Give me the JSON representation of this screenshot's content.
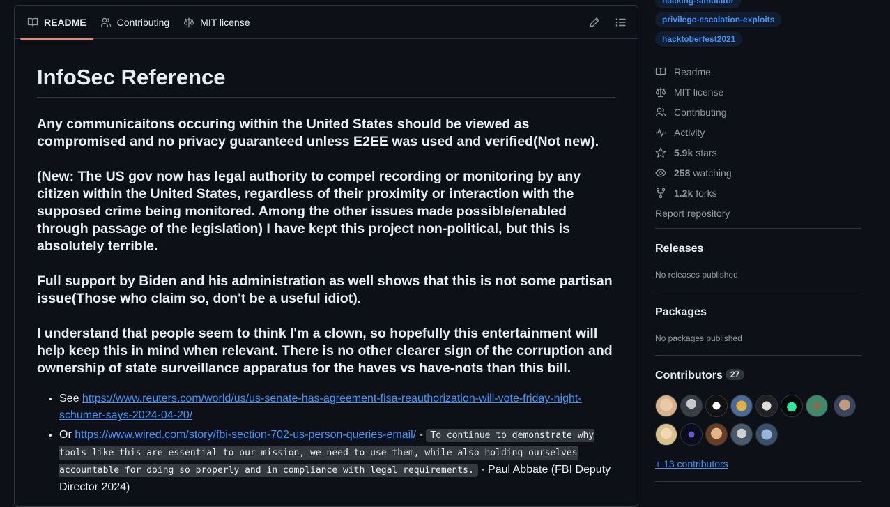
{
  "tabs": [
    {
      "label": "README",
      "icon": "book-icon",
      "active": true
    },
    {
      "label": "Contributing",
      "icon": "people-icon"
    },
    {
      "label": "MIT license",
      "icon": "law-icon"
    }
  ],
  "actions": {
    "edit_icon": "pencil-icon",
    "toc_icon": "list-icon"
  },
  "readme": {
    "title": "InfoSec Reference",
    "paragraphs": [
      "Any communicaitons occuring within the United States should be viewed as compromised and no privacy guaranteed unless E2EE was used and verified(Not new).",
      "(New: The US gov now has legal authority to compel recording or monitoring by any citizen within the United States, regardless of their proximity or interaction with the supposed crime being monitored. Among the other issues made possible/enabled through passage of the legislation) I have kept this project non-political, but this is absolutely terrible.",
      "Full support by Biden and his administration as well shows that this is not some partisan issue(Those who claim so, don't be a useful idiot).",
      "I understand that people seem to think I'm a clown, so hopefully this entertainment will help keep this in mind when relevant. There is no other clearer sign of the corruption and ownership of state surveillance apparatus for the haves vs have-nots than this bill."
    ],
    "list": [
      {
        "prefix": "See ",
        "link": "https://www.reuters.com/world/us/us-senate-has-agreement-fisa-reauthorization-will-vote-friday-night-schumer-says-2024-04-20/"
      },
      {
        "prefix": "Or ",
        "link": "https://www.wired.com/story/fbi-section-702-us-person-queries-email/",
        "sep": " - ",
        "code": "To continue to demonstrate why tools like this are essential to our mission, we need to use them, while also holding ourselves accountable for doing so properly and in compliance with legal requirements.",
        "suffix": " - Paul Abbate (FBI Deputy Director 2024)"
      }
    ]
  },
  "sidebar": {
    "topics": [
      "hacking-simulator",
      "privilege-escalation-exploits",
      "hacktoberfest2021"
    ],
    "meta": [
      {
        "label": "Readme",
        "icon": "book-icon"
      },
      {
        "label": "MIT license",
        "icon": "law-icon"
      },
      {
        "label": "Contributing",
        "icon": "people-icon"
      },
      {
        "label": "Activity",
        "icon": "pulse-icon"
      },
      {
        "count": "5.9k",
        "label": "stars",
        "icon": "star-icon"
      },
      {
        "count": "258",
        "label": "watching",
        "icon": "eye-icon"
      },
      {
        "count": "1.2k",
        "label": "forks",
        "icon": "fork-icon"
      }
    ],
    "report": "Report repository",
    "releases": {
      "title": "Releases",
      "sub": "No releases published"
    },
    "packages": {
      "title": "Packages",
      "sub": "No packages published"
    },
    "contributors": {
      "title": "Contributors",
      "count": "27",
      "more": "+ 13 contributors"
    }
  },
  "colors": {
    "accent": "#f78166",
    "link": "#4493f8",
    "bg": "#0d1117",
    "border": "#30363d"
  }
}
